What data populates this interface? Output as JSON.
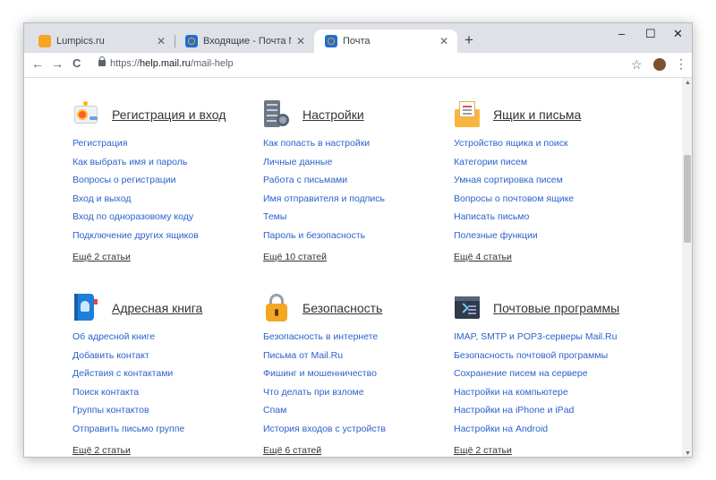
{
  "browser": {
    "tabs": [
      {
        "title": "Lumpics.ru",
        "favicon": "lumpics-icon",
        "active": false
      },
      {
        "title": "Входящие - Почта Mail.Ru",
        "favicon": "mailru-icon",
        "active": false
      },
      {
        "title": "Почта",
        "favicon": "mailru-icon",
        "active": true
      }
    ],
    "new_tab": "+",
    "window_controls": {
      "minimize": "–",
      "maximize": "☐",
      "close": "✕"
    },
    "nav": {
      "back": "←",
      "forward": "→",
      "reload": "C"
    },
    "url_prefix": "https://",
    "url_host": "help.mail.ru",
    "url_path": "/mail-help",
    "bookmark_star": "☆",
    "menu": "⋮"
  },
  "categories": [
    {
      "title": "Регистрация и вход",
      "icon": "registration-icon",
      "links": [
        "Регистрация",
        "Как выбрать имя и пароль",
        "Вопросы о регистрации",
        "Вход и выход",
        "Вход по одноразовому коду",
        "Подключение других ящиков"
      ],
      "more": "Ещё 2 статьи"
    },
    {
      "title": "Настройки",
      "icon": "settings-icon",
      "links": [
        "Как попасть в настройки",
        "Личные данные",
        "Работа с письмами",
        "Имя отправителя и подпись",
        "Темы",
        "Пароль и безопасность"
      ],
      "more": "Ещё 10 статей"
    },
    {
      "title": "Ящик и письма",
      "icon": "mailbox-icon",
      "links": [
        "Устройство ящика и поиск",
        "Категории писем",
        "Умная сортировка писем",
        "Вопросы о почтовом ящике",
        "Написать письмо",
        "Полезные функции"
      ],
      "more": "Ещё 4 статьи"
    },
    {
      "title": "Адресная книга",
      "icon": "address-book-icon",
      "links": [
        "Об адресной книге",
        "Добавить контакт",
        "Действия с контактами",
        "Поиск контакта",
        "Группы контактов",
        "Отправить письмо группе"
      ],
      "more": "Ещё 2 статьи"
    },
    {
      "title": "Безопасность",
      "icon": "lock-icon",
      "links": [
        "Безопасность в интернете",
        "Письма от Mail.Ru",
        "Фишинг и мошенничество",
        "Что делать при взломе",
        "Спам",
        "История входов с устройств"
      ],
      "more": "Ещё 6 статей"
    },
    {
      "title": "Почтовые программы",
      "icon": "mail-programs-icon",
      "links": [
        "IMAP, SMTP и POP3-серверы Mail.Ru",
        "Безопасность почтовой программы",
        "Сохранение писем на сервере",
        "Настройки на компьютере",
        "Настройки на iPhone и iPad",
        "Настройки на Android"
      ],
      "more": "Ещё 2 статьи"
    }
  ],
  "colors": {
    "link": "#2b62cc",
    "heading": "#333333",
    "tabstrip": "#dee1e6"
  }
}
